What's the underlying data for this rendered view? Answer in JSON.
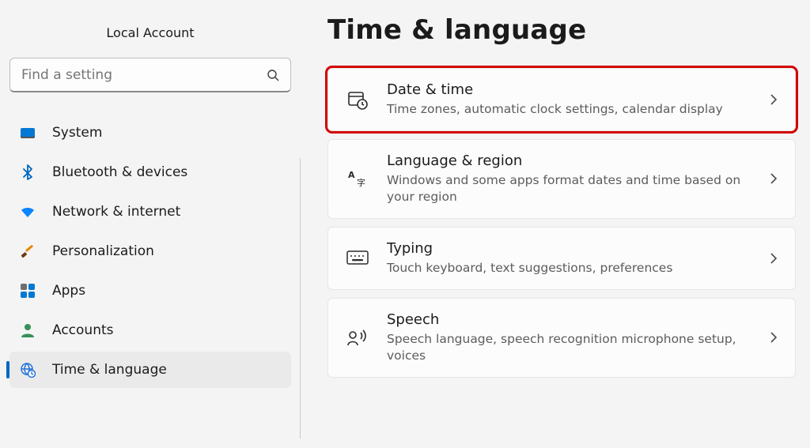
{
  "account": {
    "label": "Local Account"
  },
  "search": {
    "placeholder": "Find a setting"
  },
  "sidebar": {
    "items": [
      {
        "label": "System"
      },
      {
        "label": "Bluetooth & devices"
      },
      {
        "label": "Network & internet"
      },
      {
        "label": "Personalization"
      },
      {
        "label": "Apps"
      },
      {
        "label": "Accounts"
      },
      {
        "label": "Time & language"
      }
    ],
    "active_index": 6
  },
  "page": {
    "title": "Time & language",
    "items": [
      {
        "title": "Date & time",
        "subtitle": "Time zones, automatic clock settings, calendar display",
        "highlighted": true
      },
      {
        "title": "Language & region",
        "subtitle": "Windows and some apps format dates and time based on your region",
        "highlighted": false
      },
      {
        "title": "Typing",
        "subtitle": "Touch keyboard, text suggestions, preferences",
        "highlighted": false
      },
      {
        "title": "Speech",
        "subtitle": "Speech language, speech recognition microphone setup, voices",
        "highlighted": false
      }
    ]
  }
}
